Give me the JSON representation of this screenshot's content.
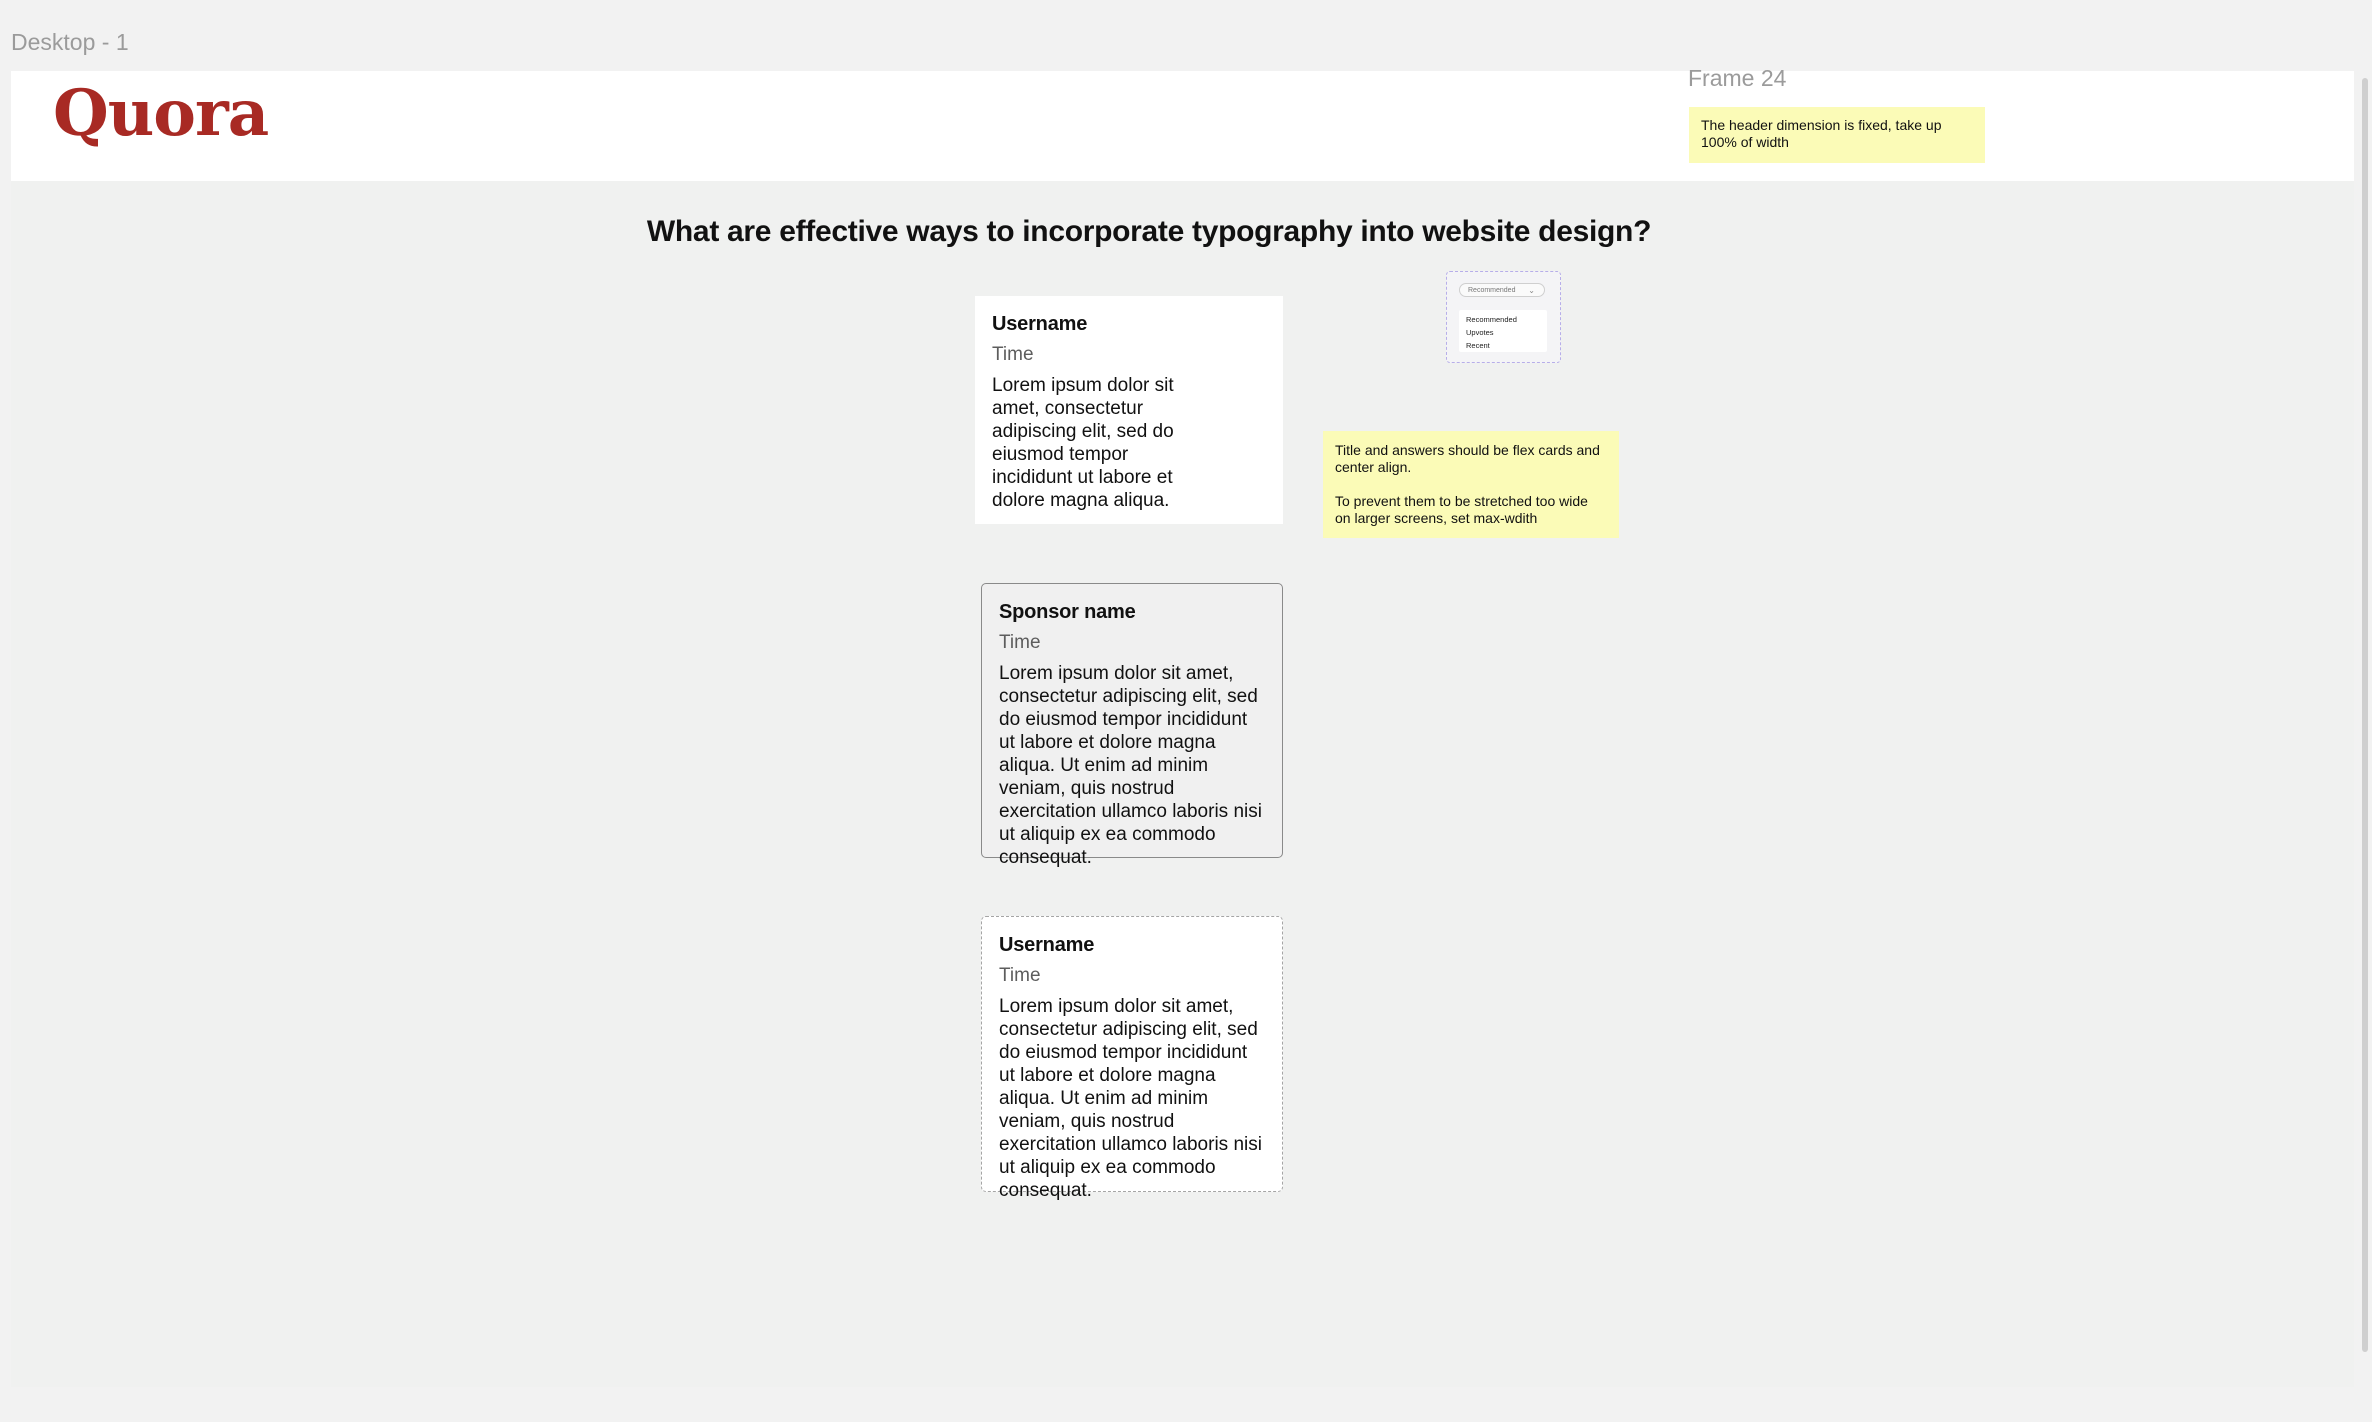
{
  "canvas": {
    "frame_label": "Desktop - 1",
    "side_frame_label": "Frame 24"
  },
  "header": {
    "logo": "Quora"
  },
  "question": {
    "title": "What are effective ways to incorporate typography into website design?"
  },
  "answers": [
    {
      "name": "Username",
      "time": "Time",
      "body": "Lorem ipsum dolor sit amet, consectetur adipiscing elit, sed do eiusmod tempor incididunt ut labore et dolore magna aliqua."
    },
    {
      "name": "Sponsor name",
      "time": "Time",
      "body": "Lorem ipsum dolor sit amet, consectetur adipiscing elit, sed do eiusmod tempor incididunt ut labore et dolore magna aliqua. Ut enim ad minim veniam, quis nostrud exercitation ullamco laboris nisi ut aliquip ex ea commodo consequat."
    },
    {
      "name": "Username",
      "time": "Time",
      "body": "Lorem ipsum dolor sit amet, consectetur adipiscing elit, sed do eiusmod tempor incididunt ut labore et dolore magna aliqua. Ut enim ad minim veniam, quis nostrud exercitation ullamco laboris nisi ut aliquip ex ea commodo consequat."
    }
  ],
  "sort_dropdown": {
    "selected": "Recommended",
    "options": [
      "Recommended",
      "Upvotes",
      "Recent"
    ]
  },
  "notes": {
    "header_note": "The header dimension is fixed, take up 100% of width",
    "layout_note_1": "Title and answers should be flex cards and center align.",
    "layout_note_2": "To prevent them to be stretched too wide on larger screens, set max-wdith"
  },
  "colors": {
    "brand": "#a82a24",
    "sticky_note": "#fbfbb7",
    "canvas_bg": "#f0f1f0",
    "dropdown_outline": "#b7aee9"
  }
}
